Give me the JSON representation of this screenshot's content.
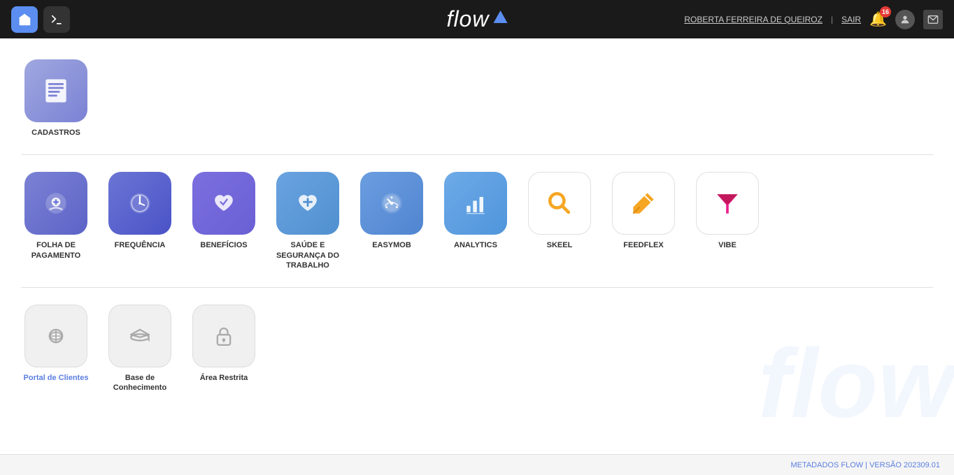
{
  "header": {
    "logo_text": "flow",
    "user_name": "ROBERTA FERREIRA DE QUEIROZ",
    "separator": "|",
    "sair_label": "SAIR",
    "notification_count": "16"
  },
  "sections": {
    "section1": {
      "items": [
        {
          "id": "cadastros",
          "label": "CADASTROS",
          "icon_type": "cadastros",
          "linkable": false
        }
      ]
    },
    "section2": {
      "items": [
        {
          "id": "folha",
          "label": "FOLHA DE PAGAMENTO",
          "icon_type": "folha",
          "linkable": false
        },
        {
          "id": "frequencia",
          "label": "FREQUÊNCIA",
          "icon_type": "frequencia",
          "linkable": false
        },
        {
          "id": "beneficios",
          "label": "BENEFÍCIOS",
          "icon_type": "beneficios",
          "linkable": false
        },
        {
          "id": "saude",
          "label": "SAÚDE E SEGURANÇA DO TRABALHO",
          "icon_type": "saude",
          "linkable": false
        },
        {
          "id": "easymob",
          "label": "EASYMOB",
          "icon_type": "easymob",
          "linkable": false
        },
        {
          "id": "analytics",
          "label": "ANALYTICS",
          "icon_type": "analytics",
          "linkable": false
        },
        {
          "id": "skeel",
          "label": "SKEEL",
          "icon_type": "skeel",
          "linkable": false
        },
        {
          "id": "feedflex",
          "label": "FEEDFLEX",
          "icon_type": "feedflex",
          "linkable": false
        },
        {
          "id": "vibe",
          "label": "VIBE",
          "icon_type": "vibe",
          "linkable": false
        }
      ]
    },
    "section3": {
      "items": [
        {
          "id": "portal",
          "label": "Portal de Clientes",
          "icon_type": "gray",
          "linkable": true
        },
        {
          "id": "base",
          "label": "Base de Conhecimento",
          "icon_type": "gray",
          "linkable": true
        },
        {
          "id": "area",
          "label": "Área Restrita",
          "icon_type": "gray",
          "linkable": true
        }
      ]
    }
  },
  "footer": {
    "text": "METADADOS FLOW | VERSÃO 202309.01"
  }
}
